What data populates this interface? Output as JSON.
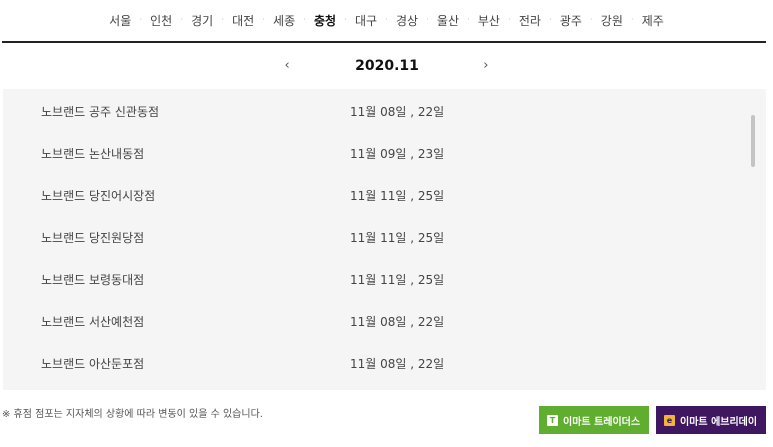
{
  "regions": [
    {
      "label": "서울",
      "active": false
    },
    {
      "label": "인천",
      "active": false
    },
    {
      "label": "경기",
      "active": false
    },
    {
      "label": "대전",
      "active": false
    },
    {
      "label": "세종",
      "active": false
    },
    {
      "label": "충청",
      "active": true
    },
    {
      "label": "대구",
      "active": false
    },
    {
      "label": "경상",
      "active": false
    },
    {
      "label": "울산",
      "active": false
    },
    {
      "label": "부산",
      "active": false
    },
    {
      "label": "전라",
      "active": false
    },
    {
      "label": "광주",
      "active": false
    },
    {
      "label": "강원",
      "active": false
    },
    {
      "label": "제주",
      "active": false
    }
  ],
  "month_nav": {
    "prev": "‹",
    "current": "2020.11",
    "next": "›"
  },
  "stores": [
    {
      "name": "노브랜드 공주 신관동점",
      "dates": "11월 08일 , 22일"
    },
    {
      "name": "노브랜드 논산내동점",
      "dates": "11월 09일 , 23일"
    },
    {
      "name": "노브랜드 당진어시장점",
      "dates": "11월 11일 , 25일"
    },
    {
      "name": "노브랜드 당진원당점",
      "dates": "11월 11일 , 25일"
    },
    {
      "name": "노브랜드 보령동대점",
      "dates": "11월 11일 , 25일"
    },
    {
      "name": "노브랜드 서산예천점",
      "dates": "11월 08일 , 22일"
    },
    {
      "name": "노브랜드 아산둔포점",
      "dates": "11월 08일 , 22일"
    }
  ],
  "notice": "※ 휴점 점포는 지자체의 상황에 따라 변동이 있을 수 있습니다.",
  "buttons": {
    "traders": {
      "label": "이마트 트레이더스",
      "icon_text": "T",
      "color": "#5fae2f"
    },
    "everyday": {
      "label": "이마트 에브리데이",
      "icon_text": "e",
      "color": "#3f1660"
    }
  }
}
